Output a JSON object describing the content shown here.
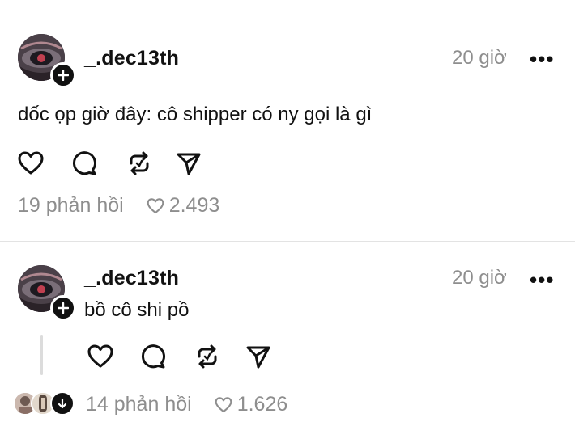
{
  "post1": {
    "username": "_.dec13th",
    "time": "20 giờ",
    "more": "•••",
    "text": "dốc ọp giờ đây: cô shipper có ny gọi là gì",
    "replies": "19 phản hồi",
    "likes": "2.493"
  },
  "post2": {
    "username": "_.dec13th",
    "time": "20 giờ",
    "more": "•••",
    "text": "bồ cô shi pồ",
    "replies": "14 phản hồi",
    "likes": "1.626"
  },
  "icons": [
    "heart-icon",
    "comment-icon",
    "repost-icon",
    "share-icon",
    "plus-icon",
    "arrow-down-icon"
  ]
}
